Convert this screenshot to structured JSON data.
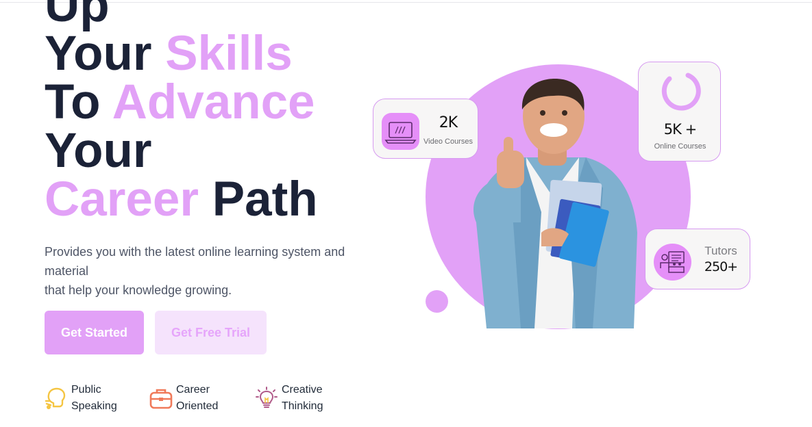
{
  "hero": {
    "line1": "Up",
    "line2_a": "Your",
    "line2_b": "Skills",
    "line3_a": "To",
    "line3_b": "Advance",
    "line4": "Your",
    "line5_a": "Career",
    "line5_b": "Path",
    "description_1": "Provides you with the latest online learning system and material",
    "description_2": "that help your knowledge growing."
  },
  "buttons": {
    "get_started": "Get Started",
    "free_trial": "Get Free Trial"
  },
  "features": [
    {
      "line1": "Public",
      "line2": "Speaking",
      "icon": "head-speaking-icon",
      "color": "#f5c542"
    },
    {
      "line1": "Career",
      "line2": "Oriented",
      "icon": "briefcase-icon",
      "color": "#f07a5a"
    },
    {
      "line1": "Creative",
      "line2": "Thinking",
      "icon": "lightbulb-icon",
      "color": "#b05a8a"
    }
  ],
  "stats": {
    "video": {
      "value": "2K",
      "label": "Video Courses",
      "icon": "laptop-icon"
    },
    "online": {
      "value": "5K +",
      "label": "Online Courses",
      "icon": "progress-ring-icon"
    },
    "tutors": {
      "value": "250+",
      "label": "Tutors",
      "icon": "presentation-icon"
    }
  },
  "colors": {
    "accent": "#e2a1f7",
    "dark_text": "#1b2237",
    "icon_box": "#e58ff8"
  }
}
